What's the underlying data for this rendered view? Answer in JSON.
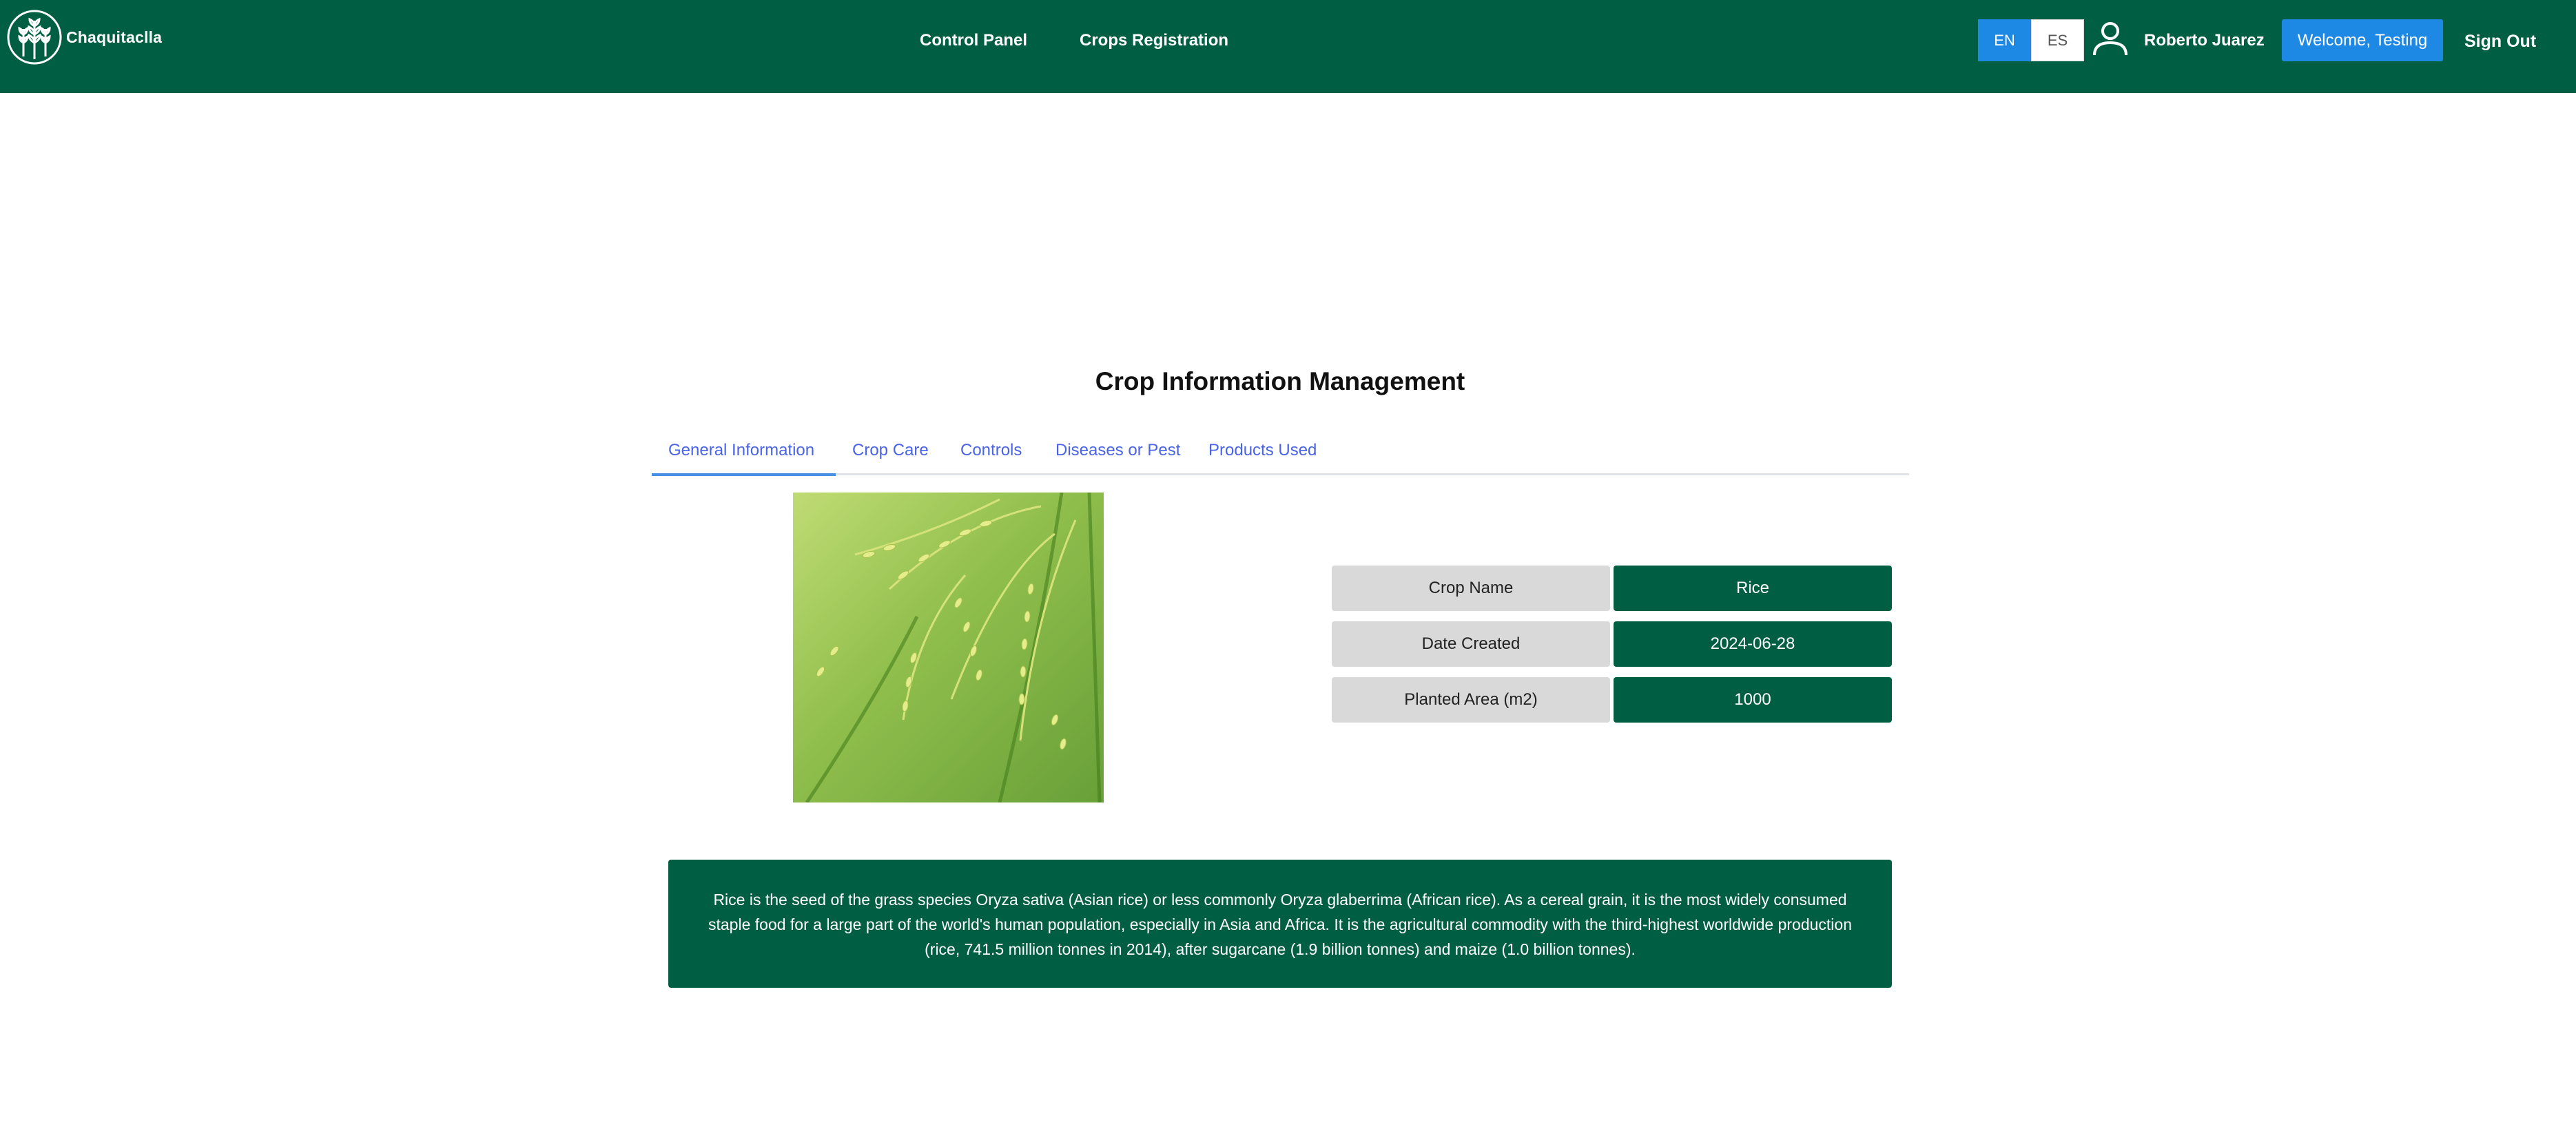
{
  "header": {
    "brand": "Chaquitaclla",
    "nav": {
      "control_panel": "Control Panel",
      "crops_registration": "Crops Registration"
    },
    "lang": {
      "en": "EN",
      "es": "ES"
    },
    "user_name": "Roberto Juarez",
    "welcome_label": "Welcome, Testing",
    "signout_label": "Sign Out"
  },
  "main": {
    "title": "Crop Information Management",
    "tabs": [
      {
        "label": "General Information",
        "active": true
      },
      {
        "label": "Crop Care"
      },
      {
        "label": "Controls"
      },
      {
        "label": "Diseases or Pest"
      },
      {
        "label": "Products Used"
      }
    ],
    "info": [
      {
        "label": "Crop Name",
        "value": "Rice"
      },
      {
        "label": "Date Created",
        "value": "2024-06-28"
      },
      {
        "label": "Planted Area (m2)",
        "value": "1000"
      }
    ],
    "description": "Rice is the seed of the grass species Oryza sativa (Asian rice) or less commonly Oryza glaberrima (African rice). As a cereal grain, it is the most widely consumed staple food for a large part of the world's human population, especially in Asia and Africa. It is the agricultural commodity with the third-highest worldwide production (rice, 741.5 million tonnes in 2014), after sugarcane (1.9 billion tonnes) and maize (1.0 billion tonnes)."
  },
  "colors": {
    "header": "#005f43",
    "accent_blue": "#1e88e5",
    "tab_text": "#4a63e7",
    "label_bg": "#d9d9d9"
  },
  "icons": {
    "logo": "wheat-logo-icon",
    "user": "user-icon"
  }
}
